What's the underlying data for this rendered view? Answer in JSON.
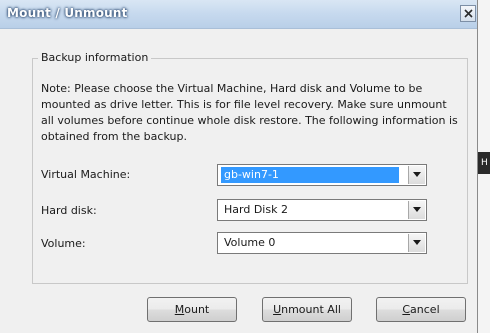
{
  "window": {
    "title": "Mount / Unmount",
    "close_glyph": "close-icon"
  },
  "background_app": {
    "panel_label": "H"
  },
  "group": {
    "legend": "Backup information",
    "note": "Note: Please choose the Virtual Machine, Hard disk and Volume to be mounted as drive letter. This is for file level recovery. Make sure unmount all volumes before continue whole disk restore. The following information is obtained from the backup."
  },
  "fields": {
    "vm": {
      "label": "Virtual Machine:",
      "value": "gb-win7-1"
    },
    "disk": {
      "label": "Hard disk:",
      "value": "Hard Disk 2"
    },
    "volume": {
      "label": "Volume:",
      "value": "Volume 0"
    }
  },
  "buttons": {
    "mount": {
      "mnemonic": "M",
      "rest": "ount"
    },
    "unmount_all": {
      "mnemonic": "U",
      "rest": "nmount All"
    },
    "cancel": {
      "mnemonic": "C",
      "rest": "ancel"
    }
  },
  "colors": {
    "selection": "#3399ff",
    "dialog_bg": "#f0f0f0",
    "title_text": "#ffffff"
  }
}
